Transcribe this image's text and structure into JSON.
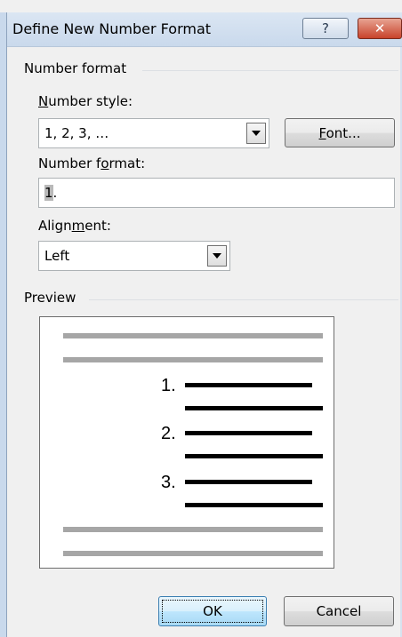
{
  "window": {
    "title": "Define New Number Format",
    "help_label": "?",
    "close_label": "✕"
  },
  "number_format_group": {
    "label": "Number format"
  },
  "number_style": {
    "label_prefix": "",
    "label_accel": "N",
    "label_rest": "umber style:",
    "value": "1, 2, 3, …"
  },
  "font_button": {
    "label_accel": "F",
    "label_rest": "ont..."
  },
  "number_format": {
    "label_pre": "Number f",
    "label_accel": "o",
    "label_post": "rmat:",
    "value_selected": "1",
    "value_rest": "."
  },
  "alignment": {
    "label_pre": "Align",
    "label_accel": "m",
    "label_post": "ent:",
    "value": "Left"
  },
  "preview_group": {
    "label": "Preview"
  },
  "preview": {
    "numbers": [
      "1.",
      "2.",
      "3."
    ]
  },
  "buttons": {
    "ok_label": "OK",
    "cancel_label": "Cancel"
  },
  "colors": {
    "preview_gray_line": "#a6a6a6",
    "preview_black_line": "#000000"
  }
}
